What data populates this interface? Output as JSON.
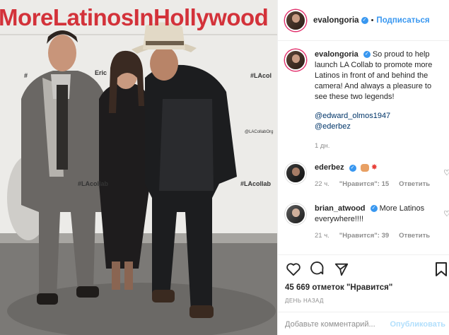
{
  "photo": {
    "banner_text": "MoreLatinosInHollywood",
    "tag_left": "#",
    "tag_right": "#LAcol",
    "tag_handle": "@LACollabOrg",
    "tag_bottom_left": "#LAcollab",
    "tag_bottom_right": "#LAcollab",
    "backdrop_name": "Eric"
  },
  "header": {
    "username": "evalongoria",
    "follow_label": "Подписаться"
  },
  "caption": {
    "username": "evalongoria",
    "text": "So proud to help launch LA Collab to promote more Latinos in front of and behind the camera! And always a pleasure to see these two legends!",
    "mention1": "@edward_olmos1947",
    "mention2": "@ederbez",
    "time": "1 дн."
  },
  "comments": [
    {
      "username": "ederbez",
      "text": "",
      "time": "22 ч.",
      "likes": "\"Нравится\": 15",
      "reply": "Ответить"
    },
    {
      "username": "brian_atwood",
      "text": "More Latinos everywhere!!!!",
      "time": "21 ч.",
      "likes": "\"Нравится\": 39",
      "reply": "Ответить"
    }
  ],
  "footer": {
    "likes_count": "45 669 отметок \"Нравится\"",
    "date": "ДЕНЬ НАЗАД",
    "comment_placeholder": "Добавьте комментарий...",
    "post_label": "Опубликовать"
  },
  "colors": {
    "accent": "#3897f0",
    "banner": "#d3323a",
    "post_disabled": "#b2dffc"
  },
  "icons": [
    "heart-icon",
    "comment-icon",
    "share-icon",
    "bookmark-icon",
    "verified-icon",
    "more-icon"
  ]
}
